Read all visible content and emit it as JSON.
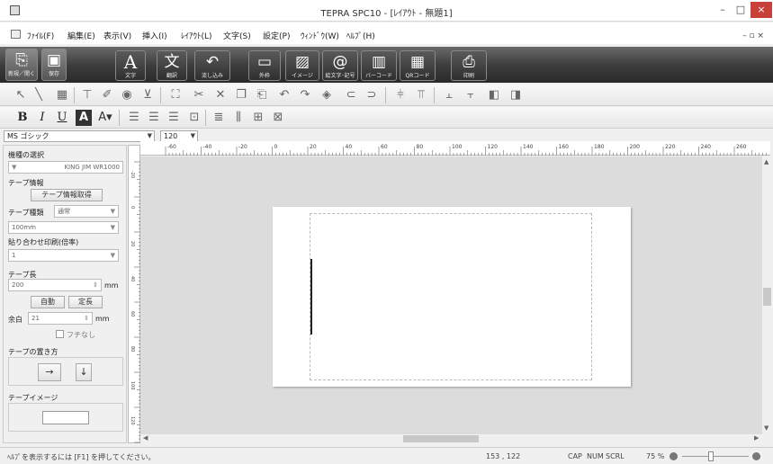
{
  "title": "TEPRA SPC10 - [ﾚｲｱｳﾄ - 無題1]",
  "menu": [
    "ﾌｧｲﾙ(F)",
    "編集(E)",
    "表示(V)",
    "挿入(I)",
    "ﾚｲｱｳﾄ(L)",
    "文字(S)",
    "設定(P)",
    "ｳｨﾝﾄﾞｳ(W)",
    "ﾍﾙﾌﾟ(H)"
  ],
  "ribbon": {
    "new_open": "新規／開く",
    "save": "保存",
    "text": "文字",
    "translate": "翻訳",
    "paste": "流し込み",
    "frame": "外枠",
    "image": "イメージ",
    "symbols": "絵文字･記号",
    "barcode": "バーコード",
    "qrcode": "QRコード",
    "print": "印刷"
  },
  "fontbar": {
    "font": "MS ゴシック",
    "size": "120"
  },
  "panel": {
    "model_label": "機種の選択",
    "model_value": "KING JIM WR1000",
    "tape_info_label": "テープ情報",
    "tape_info_button": "テープ情報取得",
    "tape_type_label": "テープ種類",
    "tape_type_value": "通常",
    "tape_width_value": "100mm",
    "tile_print_label": "貼り合わせ印刷(倍率)",
    "tile_print_value": "1",
    "tape_length_label": "テープ長",
    "tape_length_value": "200",
    "unit_mm": "mm",
    "auto_button": "自動",
    "fixed_button": "定長",
    "margin_label": "余白",
    "margin_value": "21",
    "no_edge_label": "フチなし",
    "orientation_label": "テープの置き方",
    "tape_image_label": "テープイメージ"
  },
  "ruler": {
    "h_ticks": [
      "-60",
      "-40",
      "-20",
      "0",
      "20",
      "40",
      "60",
      "80",
      "100",
      "120",
      "140",
      "160",
      "180",
      "200",
      "220",
      "240",
      "260"
    ],
    "v_ticks": [
      "-20",
      "0",
      "20",
      "40",
      "60",
      "80",
      "100",
      "120",
      "140"
    ]
  },
  "status": {
    "help": "ﾍﾙﾌﾟを表示するには [F1] を押してください。",
    "coords": "153 , 122",
    "cap": "CAP",
    "num": "NUM",
    "scrl": "SCRL",
    "zoom": "75 %"
  },
  "colors": {
    "ribbon_dark": "#3e3e3e",
    "canvas_bg": "#dcdcdc",
    "close_red": "#c8403a"
  }
}
